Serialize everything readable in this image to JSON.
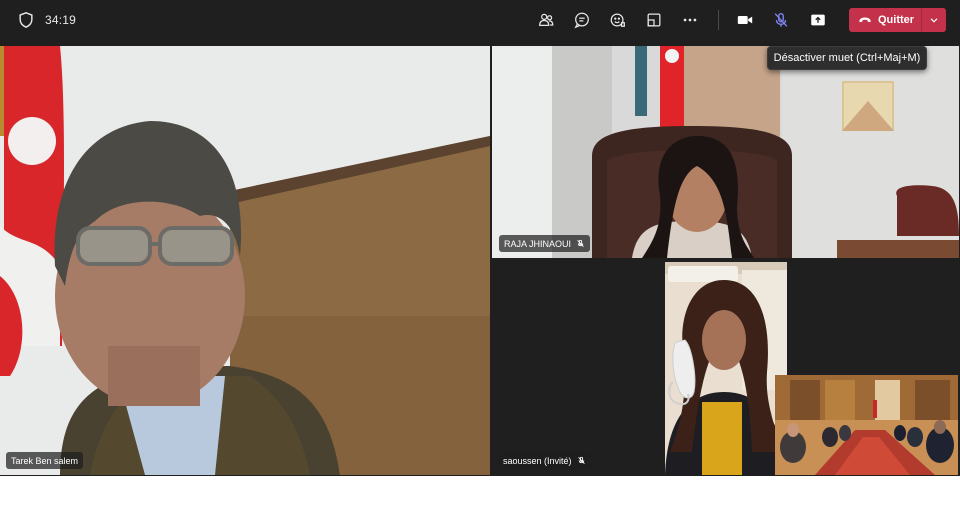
{
  "call": {
    "timer": "34:19"
  },
  "toolbar": {
    "buttons": [
      {
        "name": "participants",
        "icon": "people-icon"
      },
      {
        "name": "chat",
        "icon": "chat-icon"
      },
      {
        "name": "reactions",
        "icon": "reaction-icon"
      },
      {
        "name": "rooms",
        "icon": "rooms-icon"
      },
      {
        "name": "more",
        "icon": "more-icon"
      },
      {
        "name": "camera",
        "icon": "camera-icon"
      },
      {
        "name": "mic",
        "icon": "mic-muted-icon"
      },
      {
        "name": "share",
        "icon": "share-icon"
      }
    ],
    "leave_label": "Quitter",
    "mic_tooltip": "Désactiver muet (Ctrl+Maj+M)"
  },
  "participants": [
    {
      "name": "Tarek Ben salem",
      "muted": false
    },
    {
      "name": "RAJA JHINAOUI",
      "muted": true
    },
    {
      "name": "saoussen (Invité)",
      "muted": true
    }
  ],
  "colors": {
    "toolbar_bg": "#1f1f1f",
    "leave_red": "#c4314b",
    "tile_bg": "#1f1f1f"
  }
}
